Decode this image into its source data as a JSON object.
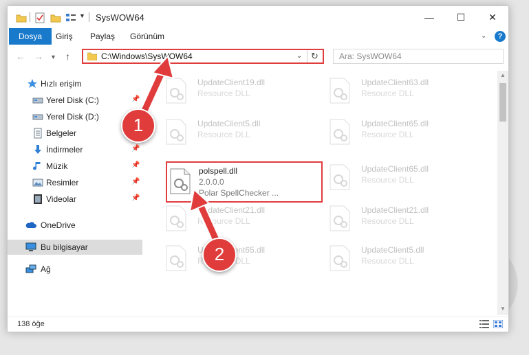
{
  "window": {
    "title": "SysWOW64"
  },
  "ribbon": {
    "tabs": [
      "Dosya",
      "Giriş",
      "Paylaş",
      "Görünüm"
    ],
    "help": "?"
  },
  "nav": {
    "address": "C:\\Windows\\SysWOW64",
    "search_placeholder": "Ara: SysWOW64"
  },
  "sidebar": {
    "quick_access": "Hızlı erişim",
    "items": [
      {
        "label": "Yerel Disk (C:)",
        "icon": "drive-icon",
        "pinned": true
      },
      {
        "label": "Yerel Disk (D:)",
        "icon": "drive-icon",
        "pinned": false
      },
      {
        "label": "Belgeler",
        "icon": "documents-icon",
        "pinned": true
      },
      {
        "label": "İndirmeler",
        "icon": "download-icon",
        "pinned": true
      },
      {
        "label": "Müzik",
        "icon": "music-icon",
        "pinned": true
      },
      {
        "label": "Resimler",
        "icon": "pictures-icon",
        "pinned": true
      },
      {
        "label": "Videolar",
        "icon": "videos-icon",
        "pinned": true
      }
    ],
    "onedrive": "OneDrive",
    "this_pc": "Bu bilgisayar",
    "network": "Ağ"
  },
  "files": [
    {
      "name": "UpdateClient19.dll",
      "desc": "Resource DLL"
    },
    {
      "name": "UpdateClient63.dll",
      "desc": "Resource DLL"
    },
    {
      "name": "UpdateClient5.dll",
      "desc": "Resource DLL"
    },
    {
      "name": "UpdateClient65.dll",
      "desc": "Resource DLL"
    },
    {
      "name": "polspell.dll",
      "desc": "2.0.0.0",
      "desc2": "Polar SpellChecker ..."
    },
    {
      "name": "UpdateClient65.dll",
      "desc": "Resource DLL"
    },
    {
      "name": "UpdateClient21.dll",
      "desc": "Resource DLL"
    },
    {
      "name": "UpdateClient21.dll",
      "desc": "Resource DLL"
    },
    {
      "name": "UpdateClient65.dll",
      "desc": "Resource DLL"
    },
    {
      "name": "UpdateClient5.dll",
      "desc": "Resource DLL"
    }
  ],
  "status": {
    "count": "138 öğe"
  },
  "annotations": {
    "step1": "1",
    "step2": "2"
  },
  "colors": {
    "accent": "#1979ca",
    "highlight": "#e03c3c"
  }
}
